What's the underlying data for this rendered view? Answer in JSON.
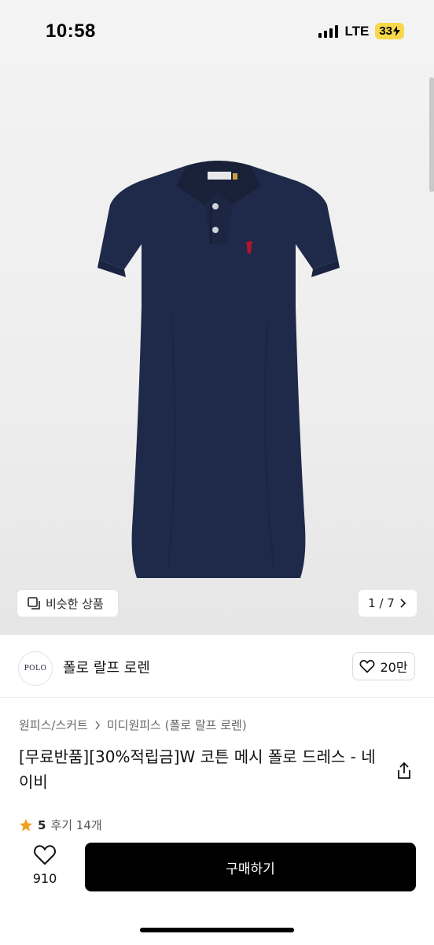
{
  "status_bar": {
    "time": "10:58",
    "network": "LTE",
    "battery": "33"
  },
  "gallery": {
    "similar_label": "비슷한 상품",
    "page_counter": "1 / 7",
    "colors": {
      "dress": "#1f2a4a",
      "logo": "#b3132b"
    }
  },
  "brand": {
    "logo_text": "POLO",
    "name": "폴로 랄프 로렌",
    "likes": "20만"
  },
  "breadcrumb": {
    "category": "원피스/스커트",
    "subcategory": "미디원피스 (폴로 랄프 로렌)"
  },
  "product": {
    "title": "[무료반품][30%적립금]W 코튼 메시 폴로 드레스 - 네이비",
    "rating": "5",
    "reviews": "후기 14개"
  },
  "bottom_bar": {
    "wish_count": "910",
    "buy_label": "구매하기"
  }
}
